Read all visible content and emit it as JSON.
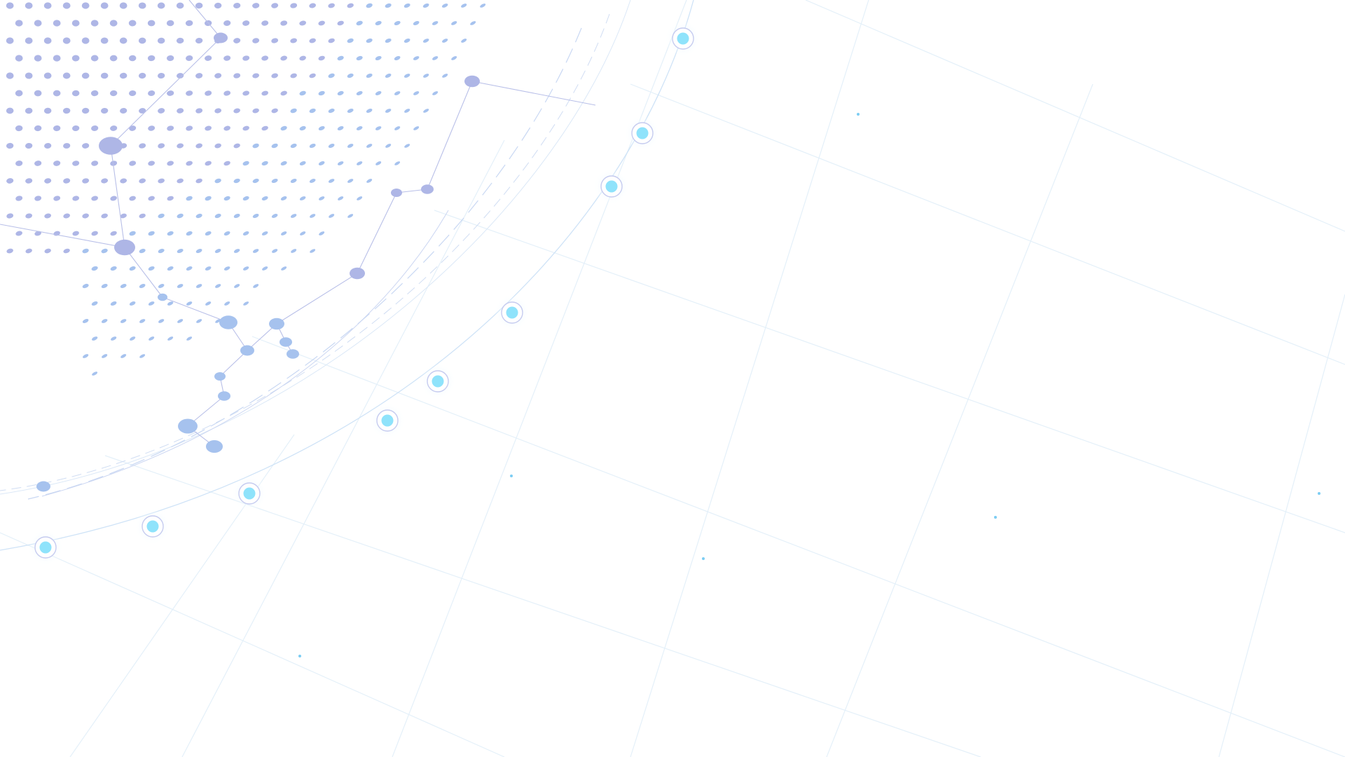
{
  "colors": {
    "background": "#ffffff",
    "globe_dots": "#aeb6e6",
    "globe_dots_edge": "#a6c2ee",
    "network_lines": "#b8bfe8",
    "node_core": "#8fe3fb",
    "node_ring": "#c6cbef",
    "orbit_line": "#cfe3f7",
    "grid_line": "#e4f0f9",
    "star_dot": "#7ccdf3"
  },
  "icons": {
    "globe": "dotted-globe-icon",
    "node": "network-node-icon"
  }
}
